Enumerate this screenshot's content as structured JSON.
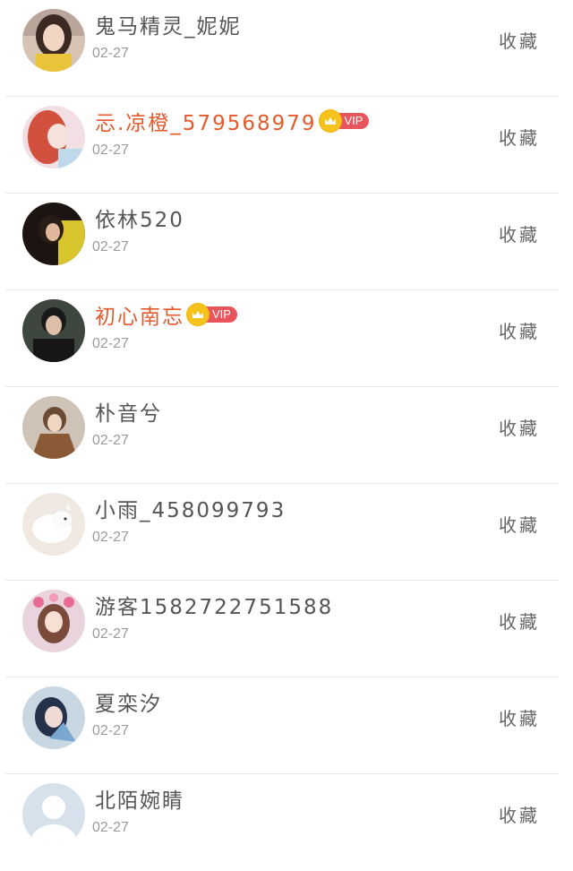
{
  "follower_list": [
    {
      "name": "鬼马精灵_妮妮",
      "date": "02-27",
      "action": "收藏",
      "vip": false,
      "avatar": "avatar-girl-yellow-shirt"
    },
    {
      "name": "忈.凉橙_579568979",
      "date": "02-27",
      "action": "收藏",
      "vip": true,
      "vip_label": "VIP",
      "avatar": "avatar-girl-red-hair"
    },
    {
      "name": "依林520",
      "date": "02-27",
      "action": "收藏",
      "vip": false,
      "avatar": "avatar-dark-hair-yellow"
    },
    {
      "name": "初心南忘",
      "date": "02-27",
      "action": "收藏",
      "vip": true,
      "vip_label": "VIP",
      "avatar": "avatar-man-dark"
    },
    {
      "name": "朴音兮",
      "date": "02-27",
      "action": "收藏",
      "vip": false,
      "avatar": "avatar-girl-brown-coat"
    },
    {
      "name": "小雨_458099793",
      "date": "02-27",
      "action": "收藏",
      "vip": false,
      "avatar": "avatar-white-fox"
    },
    {
      "name": "游客15827227515​88",
      "date": "02-27",
      "action": "收藏",
      "vip": false,
      "avatar": "avatar-girl-flowers"
    },
    {
      "name": "夏栾汐",
      "date": "02-27",
      "action": "收藏",
      "vip": false,
      "avatar": "avatar-girl-blue"
    },
    {
      "name": "北陌婉睛",
      "date": "02-27",
      "action": "收藏",
      "vip": false,
      "avatar": "avatar-default-silhouette"
    }
  ],
  "colors": {
    "vip_name": "#e35a2c",
    "vip_badge": "#e9555c",
    "crown": "#f6c21c",
    "name": "#555555",
    "date": "#9a9a9a"
  }
}
